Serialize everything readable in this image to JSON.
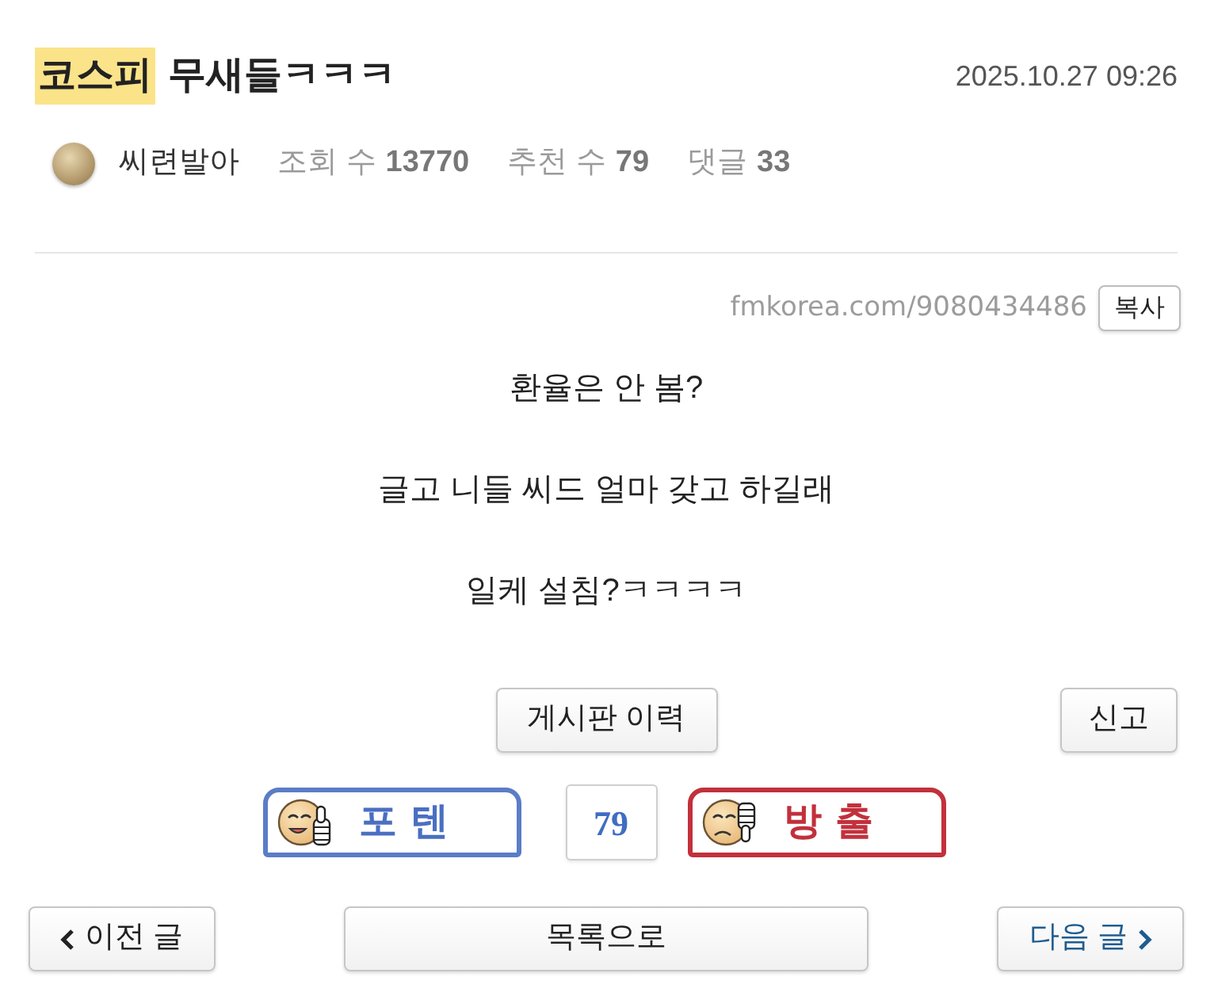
{
  "post": {
    "category": "코스피",
    "title": "무새들ㅋㅋㅋ",
    "date": "2025.10.27 09:26"
  },
  "meta": {
    "author": "씨련발아",
    "stats": [
      {
        "label": "조회 수",
        "value": "13770"
      },
      {
        "label": "추천 수",
        "value": "79"
      },
      {
        "label": "댓글",
        "value": "33"
      }
    ]
  },
  "link": {
    "url": "fmkorea.com/9080434486",
    "copy_button": "복사"
  },
  "body": [
    "환율은 안 봄?",
    "글고 니들 씨드 얼마 갖고 하길래",
    "일케 설침?ㅋㅋㅋㅋ"
  ],
  "actions": {
    "history_button": "게시판 이력",
    "report_button": "신고"
  },
  "votes": {
    "up": "포텐",
    "count": "79",
    "down": "방출"
  },
  "nav": [
    {
      "kind": "prev",
      "label": "이전 글"
    },
    {
      "kind": "list",
      "label": "목록으로"
    },
    {
      "kind": "next",
      "label": "다음 글"
    }
  ]
}
